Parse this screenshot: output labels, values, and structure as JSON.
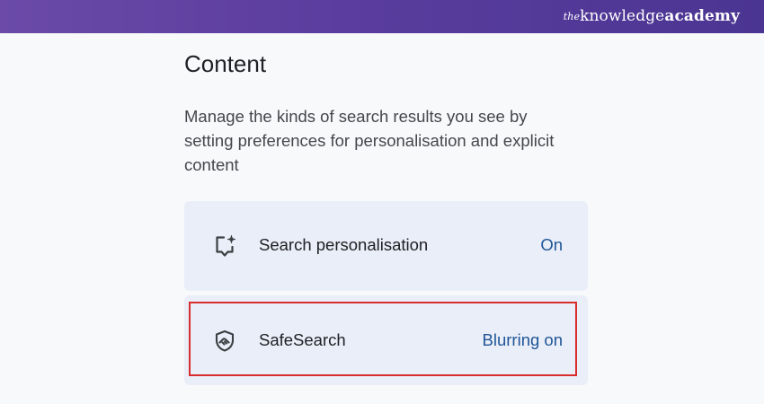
{
  "brand": {
    "the": "the",
    "knowledge": "knowledge",
    "academy": "academy"
  },
  "page": {
    "title": "Content",
    "description": "Manage the kinds of search results you see by setting preferences for personalisation and explicit content"
  },
  "settings": [
    {
      "label": "Search personalisation",
      "value": "On",
      "icon": "sparkle-comment-icon"
    },
    {
      "label": "SafeSearch",
      "value": "Blurring on",
      "icon": "shield-hand-icon",
      "highlighted": true
    }
  ],
  "colors": {
    "header_gradient_start": "#6b4aa8",
    "header_gradient_end": "#4b3592",
    "card_background": "#e9eef8",
    "value_text": "#1f5597",
    "highlight_border": "#d92c2c"
  }
}
